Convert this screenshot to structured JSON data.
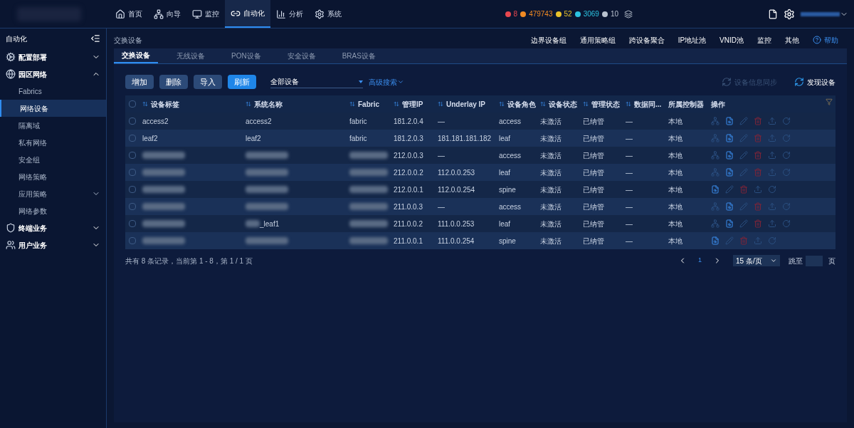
{
  "top_nav": [
    {
      "label": "首页",
      "selected": false
    },
    {
      "label": "向导",
      "selected": false
    },
    {
      "label": "监控",
      "selected": false
    },
    {
      "label": "自动化",
      "selected": true
    },
    {
      "label": "分析",
      "selected": false
    },
    {
      "label": "系统",
      "selected": false
    }
  ],
  "alarms": [
    {
      "count": "8",
      "color": "#e8474f"
    },
    {
      "count": "479743",
      "color": "#f08a24"
    },
    {
      "count": "52",
      "color": "#e9c22b"
    },
    {
      "count": "3069",
      "color": "#2bc2e0"
    },
    {
      "count": "10",
      "color": "#b9c2cf"
    }
  ],
  "sidebar": {
    "title": "自动化",
    "items": [
      {
        "label": "配置部署",
        "expanded": false
      },
      {
        "label": "园区网络",
        "expanded": true,
        "children": [
          {
            "label": "Fabrics",
            "selected": false,
            "expandable": false
          },
          {
            "label": "网络设备",
            "selected": true,
            "expandable": false
          },
          {
            "label": "隔离域",
            "selected": false,
            "expandable": false
          },
          {
            "label": "私有网络",
            "selected": false,
            "expandable": false
          },
          {
            "label": "安全组",
            "selected": false,
            "expandable": false
          },
          {
            "label": "网络策略",
            "selected": false,
            "expandable": false
          },
          {
            "label": "应用策略",
            "selected": false,
            "expandable": true
          },
          {
            "label": "网络参数",
            "selected": false,
            "expandable": false
          }
        ]
      },
      {
        "label": "终端业务",
        "expanded": false
      },
      {
        "label": "用户业务",
        "expanded": false
      }
    ]
  },
  "breadcrumb": "交换设备",
  "top_links": [
    "边界设备组",
    "通用策略组",
    "跨设备聚合",
    "IP地址池",
    "VNID池",
    "监控",
    "其他"
  ],
  "help": "帮助",
  "tabs": [
    {
      "label": "交换设备",
      "selected": true
    },
    {
      "label": "无线设备",
      "selected": false
    },
    {
      "label": "PON设备",
      "selected": false
    },
    {
      "label": "安全设备",
      "selected": false
    },
    {
      "label": "BRAS设备",
      "selected": false
    }
  ],
  "toolbar": {
    "buttons": [
      {
        "label": "增加",
        "primary": false
      },
      {
        "label": "删除",
        "primary": false
      },
      {
        "label": "导入",
        "primary": false
      },
      {
        "label": "刷新",
        "primary": true
      }
    ],
    "filter": "全部设备",
    "advanced": "高级搜索",
    "sync": {
      "label": "设备信息同步",
      "disabled": true
    },
    "discover": {
      "label": "发现设备",
      "disabled": false
    }
  },
  "table": {
    "all_checked": false,
    "columns": [
      {
        "label": "设备标签",
        "sortable": true
      },
      {
        "label": "系统名称",
        "sortable": true
      },
      {
        "label": "Fabric",
        "sortable": true
      },
      {
        "label": "管理IP",
        "sortable": true
      },
      {
        "label": "Underlay IP",
        "sortable": true
      },
      {
        "label": "设备角色",
        "sortable": true
      },
      {
        "label": "设备状态",
        "sortable": true
      },
      {
        "label": "管理状态",
        "sortable": true
      },
      {
        "label": "数据同...",
        "sortable": true
      },
      {
        "label": "所属控制器",
        "sortable": false
      },
      {
        "label": "操作",
        "sortable": false
      }
    ],
    "rows": [
      {
        "kind": "full",
        "checked": false,
        "cells": [
          "access2",
          "access2",
          "fabric",
          "181.2.0.4",
          "—",
          "access",
          "未激活",
          "已纳管",
          "—",
          "本地"
        ]
      },
      {
        "kind": "full",
        "checked": false,
        "cells": [
          "leaf2",
          "leaf2",
          "fabric",
          "181.2.0.3",
          "181.181.181.182",
          "leaf",
          "未激活",
          "已纳管",
          "—",
          "本地"
        ]
      },
      {
        "kind": "full",
        "checked": false,
        "cells": [
          null,
          null,
          null,
          "212.0.0.3",
          "—",
          "access",
          "未激活",
          "已纳管",
          "—",
          "本地"
        ]
      },
      {
        "kind": "full",
        "checked": false,
        "cells": [
          null,
          null,
          null,
          "212.0.0.2",
          "112.0.0.253",
          "leaf",
          "未激活",
          "已纳管",
          "—",
          "本地"
        ]
      },
      {
        "kind": "short",
        "checked": false,
        "cells": [
          null,
          null,
          null,
          "212.0.0.1",
          "112.0.0.254",
          "spine",
          "未激活",
          "已纳管",
          "—",
          "本地"
        ]
      },
      {
        "kind": "full",
        "checked": false,
        "cells": [
          null,
          null,
          null,
          "211.0.0.3",
          "—",
          "access",
          "未激活",
          "已纳管",
          "—",
          "本地"
        ]
      },
      {
        "kind": "full",
        "checked": false,
        "cells": [
          null,
          "_leaf1",
          null,
          "211.0.0.2",
          "111.0.0.253",
          "leaf",
          "未激活",
          "已纳管",
          "—",
          "本地"
        ]
      },
      {
        "kind": "short",
        "checked": false,
        "cells": [
          null,
          null,
          null,
          "211.0.0.1",
          "111.0.0.254",
          "spine",
          "未激活",
          "已纳管",
          "—",
          "本地"
        ]
      }
    ]
  },
  "footer": {
    "summary": "共有 8 条记录，当前第 1 - 8，第 1 / 1 页",
    "page": "1",
    "page_size": "15 条/页",
    "jump": "跳至",
    "page_unit": "页"
  }
}
